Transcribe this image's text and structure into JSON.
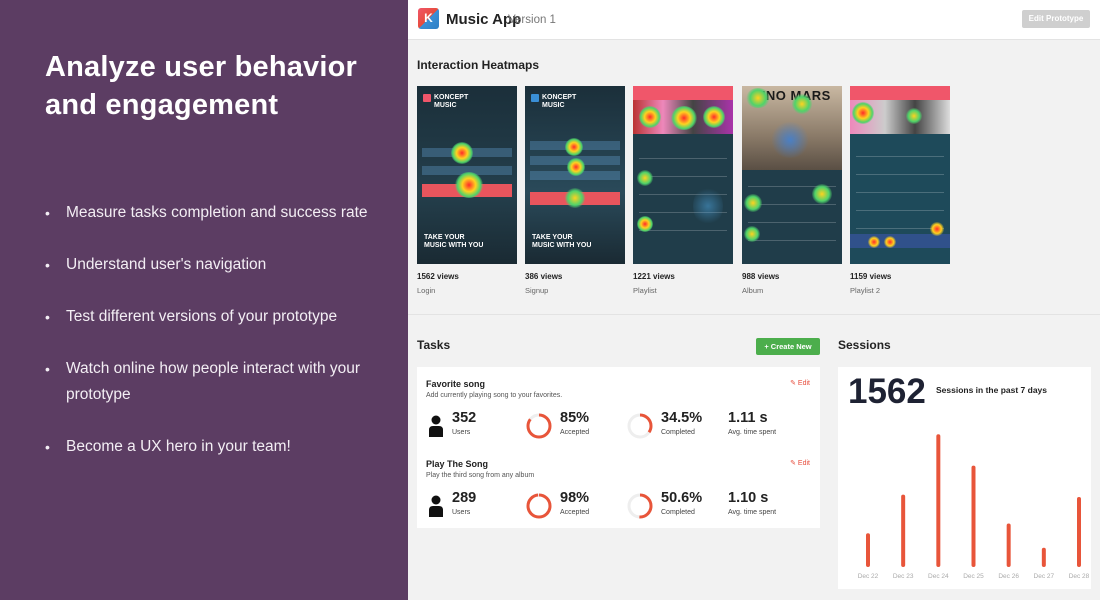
{
  "promo": {
    "title": "Analyze user behavior and engagement",
    "bullets": [
      "Measure tasks completion and success rate",
      "Understand user's navigation",
      "Test different versions of your prototype",
      "Watch online how people interact with your prototype",
      "Become a UX hero in your team!"
    ]
  },
  "topbar": {
    "logo_letter": "K",
    "title": "Music App",
    "version": "Version 1",
    "edit_prototype_label": "Edit Prototype"
  },
  "heatmaps": {
    "section_title": "Interaction Heatmaps",
    "items": [
      {
        "views": "1562 views",
        "label": "Login",
        "brand": "KONCEPT MUSIC",
        "tagline": "TAKE YOUR MUSIC WITH YOU"
      },
      {
        "views": "386 views",
        "label": "Signup",
        "brand": "KONCEPT MUSIC",
        "tagline": "TAKE YOUR MUSIC WITH YOU"
      },
      {
        "views": "1221 views",
        "label": "Playlist"
      },
      {
        "views": "988 views",
        "label": "Album",
        "album_text": "UNO MARS"
      },
      {
        "views": "1159 views",
        "label": "Playlist 2"
      }
    ]
  },
  "tasks": {
    "section_title": "Tasks",
    "create_label": "+ Create New",
    "edit_label": "✎ Edit",
    "items": [
      {
        "name": "Favorite song",
        "description": "Add currently playing song to your favorites.",
        "users": "352",
        "users_label": "Users",
        "accepted": "85%",
        "accepted_label": "Accepted",
        "accepted_fraction": 0.85,
        "completed": "34.5%",
        "completed_label": "Completed",
        "completed_fraction": 0.345,
        "time": "1.11 s",
        "time_label": "Avg. time spent"
      },
      {
        "name": "Play The Song",
        "description": "Play the third song from any album",
        "users": "289",
        "users_label": "Users",
        "accepted": "98%",
        "accepted_label": "Accepted",
        "accepted_fraction": 0.98,
        "completed": "50.6%",
        "completed_label": "Completed",
        "completed_fraction": 0.506,
        "time": "1.10 s",
        "time_label": "Avg. time spent"
      }
    ]
  },
  "sessions": {
    "section_title": "Sessions",
    "count": "1562",
    "caption": "Sessions in the past 7 days",
    "chart_data": {
      "type": "bar",
      "categories": [
        "Dec 22",
        "Dec 23",
        "Dec 24",
        "Dec 25",
        "Dec 26",
        "Dec 27",
        "Dec 28"
      ],
      "values": [
        70,
        150,
        275,
        210,
        90,
        40,
        145
      ],
      "ylim": [
        0,
        290
      ],
      "grid": false,
      "color": "#e8553a"
    }
  },
  "colors": {
    "promo_bg": "#5c3d63",
    "accent_red": "#e8553a",
    "create_green": "#4cae4c"
  }
}
